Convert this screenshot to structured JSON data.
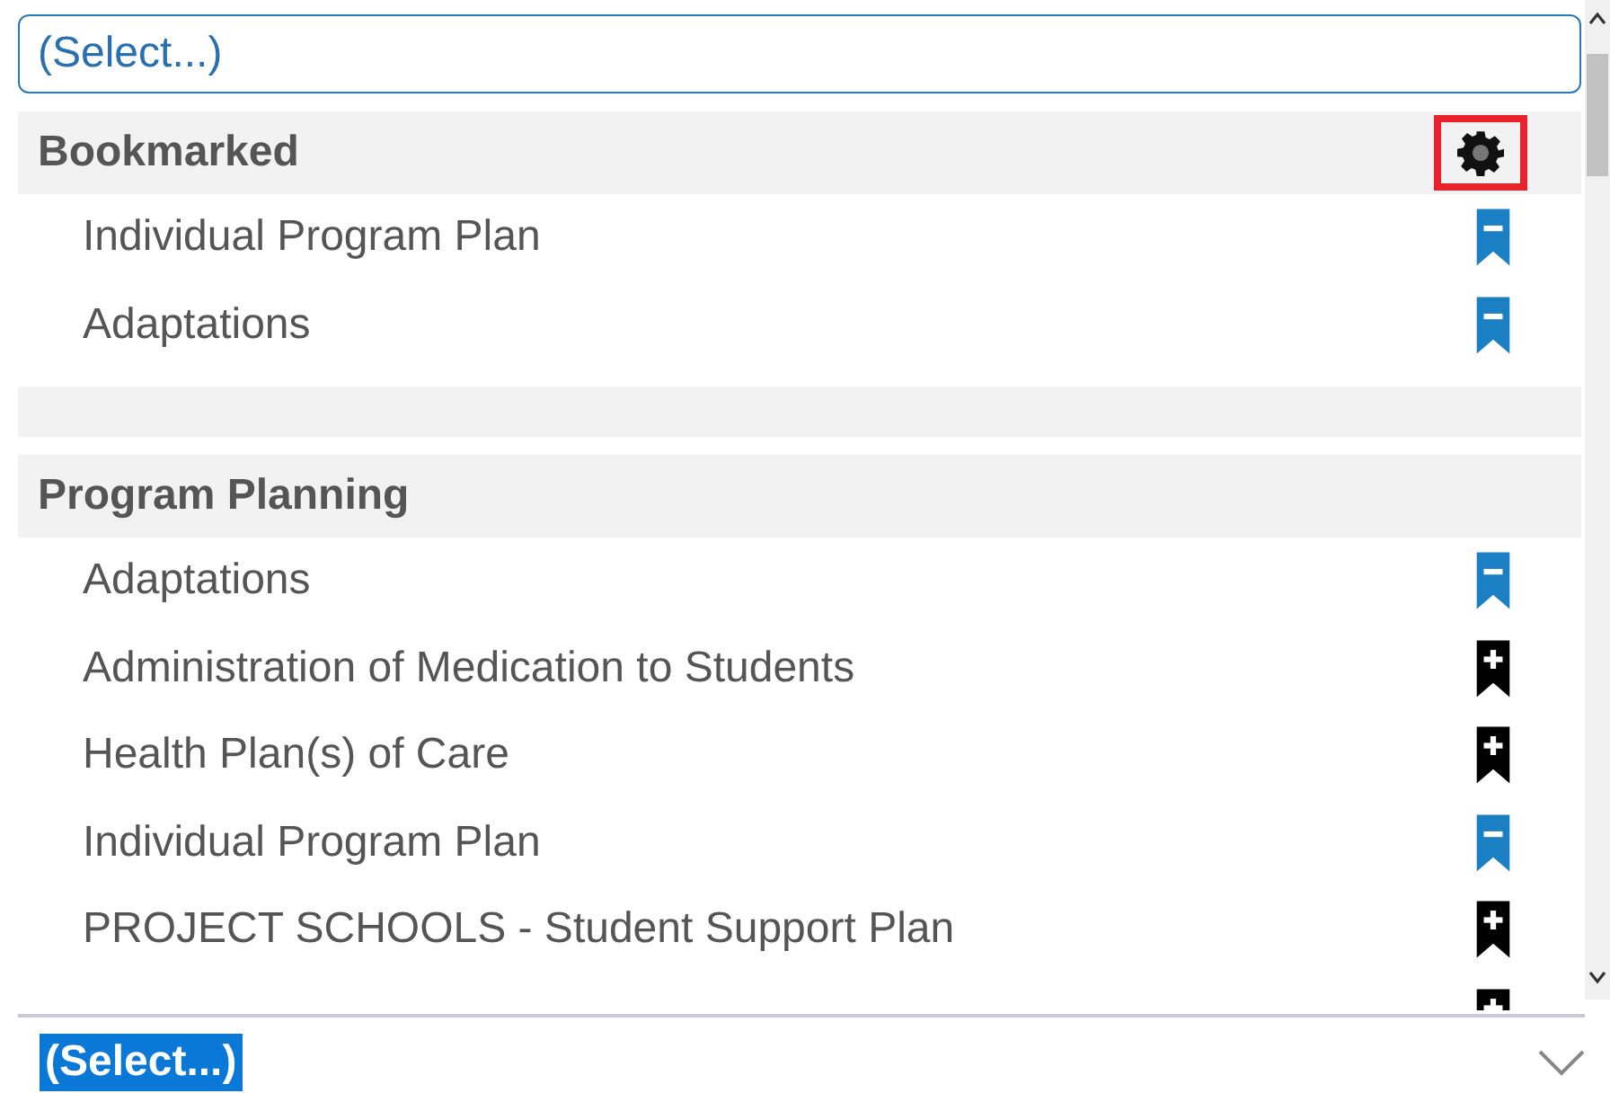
{
  "search_field": {
    "placeholder": "(Select...)"
  },
  "groups": [
    {
      "title": "Bookmarked",
      "settings": {
        "highlighted": true
      },
      "items": [
        {
          "label": "Individual Program Plan",
          "bookmarked": true
        },
        {
          "label": "Adaptations",
          "bookmarked": true
        }
      ]
    },
    {
      "title": "Program Planning",
      "items": [
        {
          "label": "Adaptations",
          "bookmarked": true
        },
        {
          "label": "Administration of Medication to Students",
          "bookmarked": false
        },
        {
          "label": "Health Plan(s) of Care",
          "bookmarked": false
        },
        {
          "label": "Individual Program Plan",
          "bookmarked": true
        },
        {
          "label": "PROJECT SCHOOLS - Student Support Plan",
          "bookmarked": false
        },
        {
          "bookmarked": false
        }
      ]
    }
  ],
  "selection": {
    "value": "(Select...)",
    "selected": true
  }
}
